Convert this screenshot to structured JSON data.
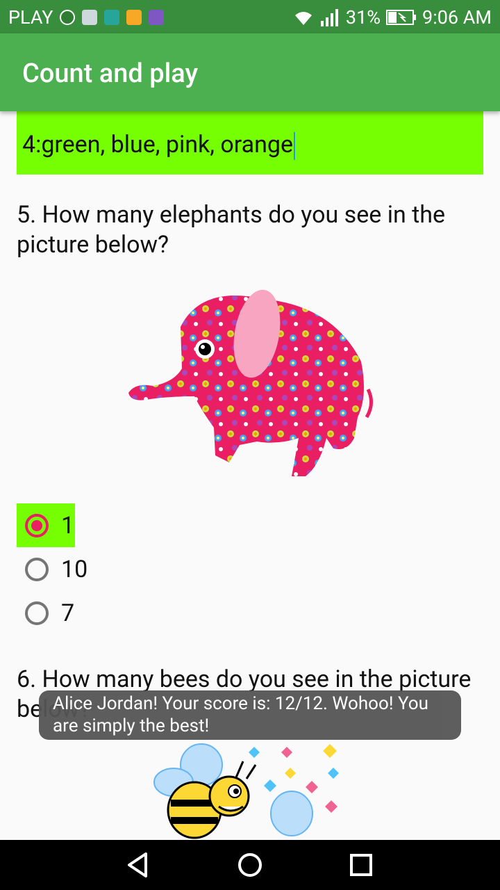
{
  "status_bar": {
    "carrier": "PLAY",
    "signal": "31%",
    "time": "9:06 AM",
    "icons": [
      "globe-icon",
      "mail-icon",
      "android-icon",
      "lock-icon",
      "image-icon"
    ],
    "right_icons": [
      "wifi-icon",
      "signal-icon",
      "battery-charging-icon"
    ]
  },
  "app_bar": {
    "title": "Count and play"
  },
  "answer_field": {
    "value": "4:green, blue, pink, orange"
  },
  "question5": {
    "text": "5. How many elephants do you see in the picture below?",
    "image": "elephant-illustration",
    "options": [
      "1",
      "10",
      "7"
    ],
    "selected_index": 0
  },
  "question6": {
    "text": "6. How many bees do you see in the picture below?",
    "image": "bees-illustration"
  },
  "toast": {
    "text": "Alice Jordan! Your score is: 12/12. Wohoo! You are simply the best!"
  },
  "nav_bar": {
    "icons": [
      "back-icon",
      "home-icon",
      "recents-icon"
    ]
  },
  "colors": {
    "status_bar": "#388e3c",
    "app_bar": "#4caf50",
    "highlight": "#76ff03",
    "radio_accent": "#e91e63",
    "toast_bg": "#555555"
  }
}
